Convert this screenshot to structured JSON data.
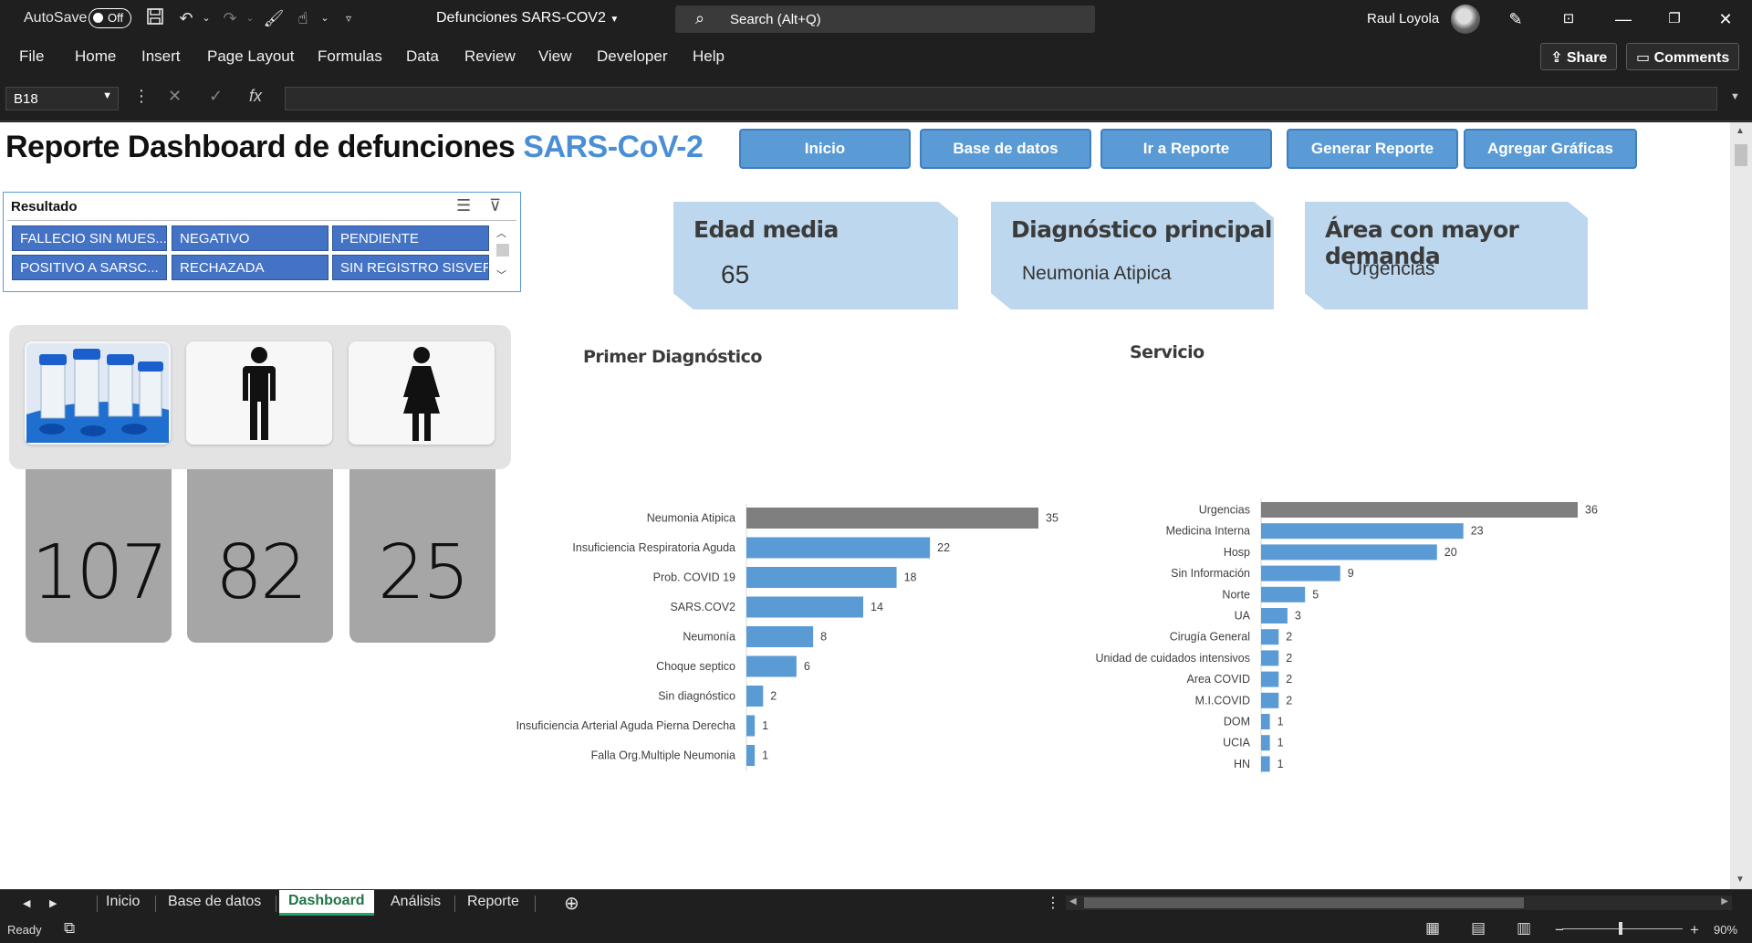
{
  "titlebar": {
    "autosave_label": "AutoSave",
    "autosave_state": "Off",
    "document_title": "Defunciones SARS-COV2",
    "search_placeholder": "Search (Alt+Q)",
    "user_name": "Raul Loyola"
  },
  "ribbon": {
    "tabs": [
      "File",
      "Home",
      "Insert",
      "Page Layout",
      "Formulas",
      "Data",
      "Review",
      "View",
      "Developer",
      "Help"
    ],
    "share_label": "Share",
    "comments_label": "Comments"
  },
  "formula_bar": {
    "name_box": "B18",
    "fx_label": "fx"
  },
  "dashboard": {
    "title_main": "Reporte Dashboard de defunciones ",
    "title_accent": "SARS-CoV-2",
    "nav_buttons": [
      "Inicio",
      "Base de datos",
      "Ir a Reporte",
      "Generar Reporte",
      "Agregar Gráficas"
    ],
    "slicer": {
      "title": "Resultado",
      "items": [
        "FALLECIO SIN MUES...",
        "NEGATIVO",
        "PENDIENTE",
        "POSITIVO  A SARSC...",
        "RECHAZADA",
        "SIN REGISTRO SISVER"
      ]
    },
    "kpis": [
      {
        "label": "Edad media",
        "value": "65"
      },
      {
        "label": "Diagnóstico principal",
        "value": "Neumonia Atipica"
      },
      {
        "label": "Área con mayor demanda",
        "value": "Urgencias"
      }
    ],
    "counts": {
      "total": "107",
      "male": "82",
      "female": "25"
    }
  },
  "chart_data": [
    {
      "type": "bar",
      "orientation": "horizontal",
      "title": "Primer Diagnóstico",
      "categories": [
        "Neumonia Atipica",
        "Insuficiencia Respiratoria Aguda",
        "Prob. COVID 19",
        "SARS.COV2",
        "Neumonía",
        "Choque septico",
        "Sin diagnóstico",
        "Insuficiencia Arterial Aguda Pierna Derecha",
        "Falla Org.Multiple Neumonia"
      ],
      "values": [
        35,
        22,
        18,
        14,
        8,
        6,
        2,
        1,
        1
      ],
      "highlight_color": "#7f7f7f",
      "bar_color": "#5b9bd5",
      "grid": false
    },
    {
      "type": "bar",
      "orientation": "horizontal",
      "title": "Servicio",
      "categories": [
        "Urgencias",
        "Medicina Interna",
        "Hosp",
        "Sin Información",
        "Norte",
        "UA",
        "Cirugía General",
        "Unidad de cuidados intensivos",
        "Area COVID",
        "M.I.COVID",
        "DOM",
        "UCIA",
        "HN"
      ],
      "values": [
        36,
        23,
        20,
        9,
        5,
        3,
        2,
        2,
        2,
        2,
        1,
        1,
        1
      ],
      "highlight_color": "#7f7f7f",
      "bar_color": "#5b9bd5",
      "grid": false
    }
  ],
  "sheet_tabs": [
    "Inicio",
    "Base de datos",
    "Dashboard",
    "Análisis",
    "Reporte"
  ],
  "active_sheet": "Dashboard",
  "statusbar": {
    "status": "Ready",
    "zoom": "90%"
  }
}
